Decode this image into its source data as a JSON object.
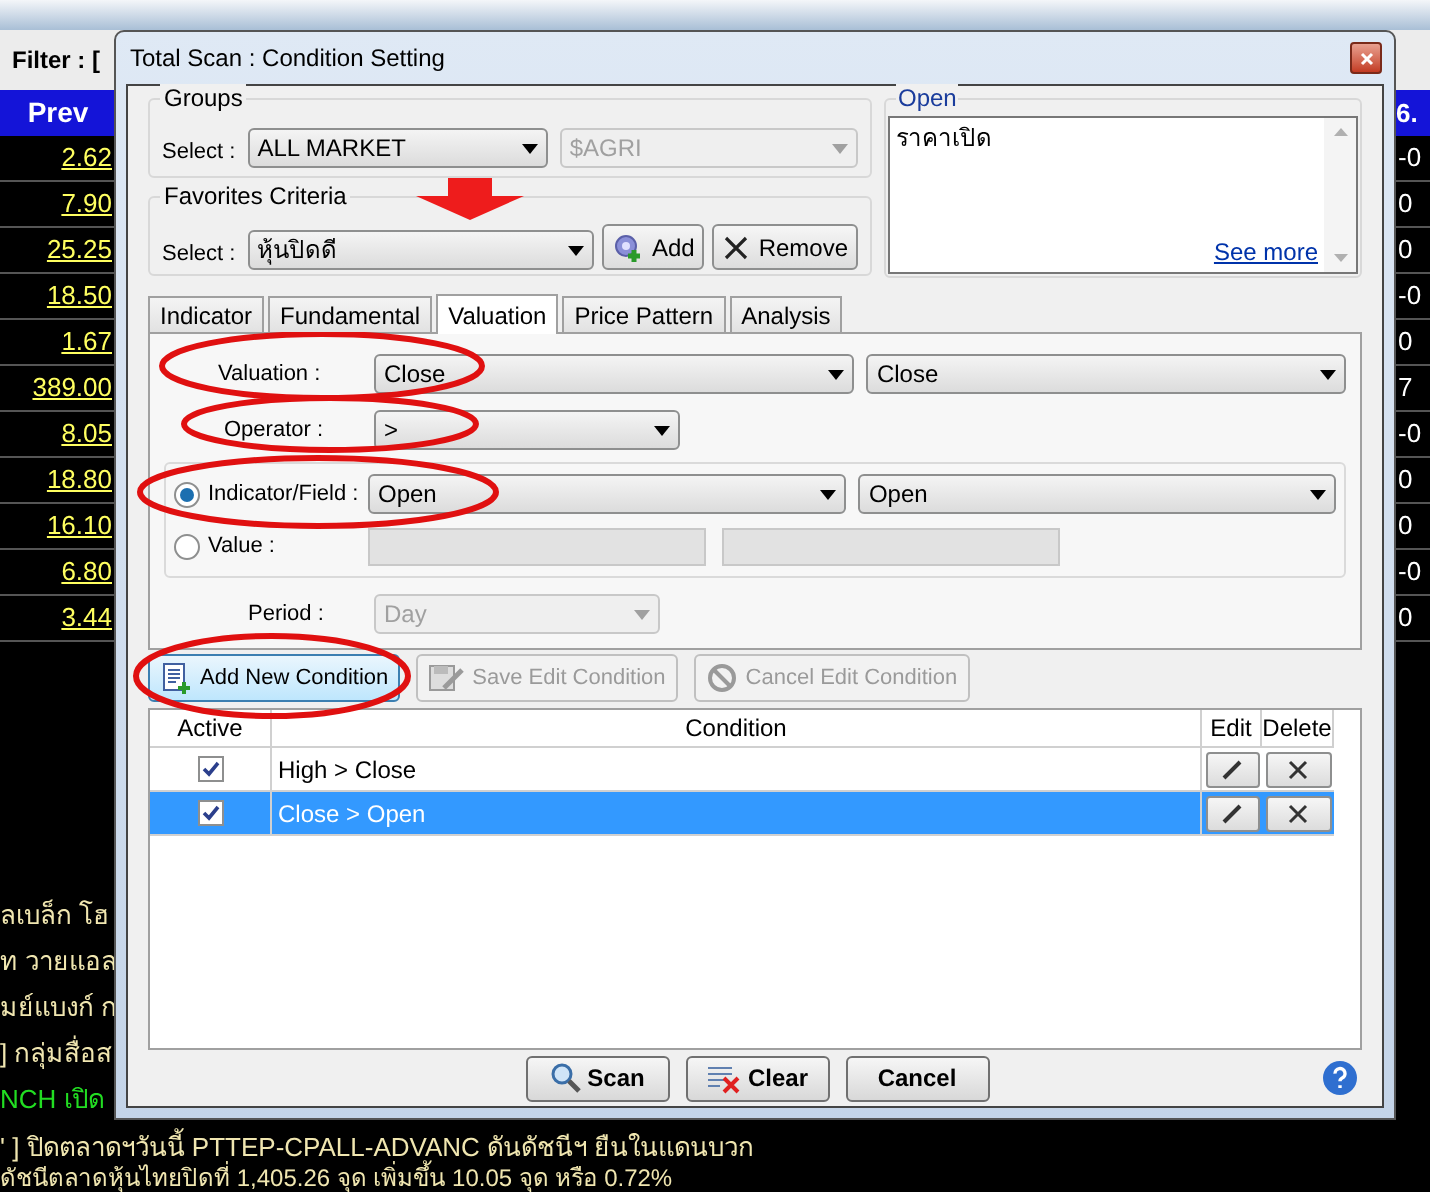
{
  "background": {
    "filter_label": "Filter : [",
    "prev_column": {
      "header": "Prev",
      "values": [
        "2.62",
        "7.90",
        "25.25",
        "18.50",
        "1.67",
        "389.00",
        "8.05",
        "18.80",
        "16.10",
        "6.80",
        "3.44"
      ]
    },
    "column_2": {
      "header": "6.",
      "values": [
        "-0",
        "0",
        "0",
        "-0",
        "0",
        "7",
        "-0",
        "0",
        "0",
        "-0",
        "0"
      ]
    },
    "news": [
      {
        "text": "ลเบล็ก โฮ",
        "color": "#f0e6b0"
      },
      {
        "text": "ท วายแอล",
        "color": "#f0e6b0"
      },
      {
        "text": "มย์แบงก์ ก",
        "color": "#f0e6b0"
      },
      {
        "text": "]  กลุ่มสื่อส",
        "color": "#f0e6b0"
      },
      {
        "text": "NCH เปิด",
        "color": "#22dd22"
      },
      {
        "text": "' ]  ปิดตลาดฯวันนี้ PTTEP-CPALL-ADVANC ดันดัชนีฯ ยืนในแดนบวก",
        "color": "#f0e6b0"
      },
      {
        "text": "ดัชนีตลาดหุ้นไทยปิดที่ 1,405.26 จุด เพิ่มขึ้น 10.05 จุด หรือ 0.72%",
        "color": "#f0e6b0"
      }
    ]
  },
  "dialog": {
    "title": "Total Scan : Condition Setting",
    "groups": {
      "legend": "Groups",
      "select_label": "Select :",
      "select": "ALL MARKET",
      "subgroup": {
        "value": "$AGRI",
        "disabled": true
      }
    },
    "favorites": {
      "legend": "Favorites Criteria",
      "select_label": "Select :",
      "select": "หุ้นปิดดี",
      "buttons": [
        "Add",
        "Remove"
      ]
    },
    "description": {
      "legend": "Open",
      "text": "ราคาเปิด",
      "link": "See more"
    },
    "tabs": [
      {
        "label": "Indicator",
        "selected": false
      },
      {
        "label": "Fundamental",
        "selected": false
      },
      {
        "label": "Valuation",
        "selected": true
      },
      {
        "label": "Price Pattern",
        "selected": false
      },
      {
        "label": "Analysis",
        "selected": false
      }
    ],
    "valuation": {
      "label": "Valuation :",
      "value": "Close",
      "value_2": "Close"
    },
    "operator": {
      "label": "Operator :",
      "value": ">"
    },
    "compare_options": [
      {
        "label": "Indicator/Field :",
        "selected": true,
        "value": "Open",
        "value_2": "Open"
      },
      {
        "label": "Value :",
        "selected": false
      }
    ],
    "period": {
      "label": "Period :",
      "value": "Day",
      "disabled": true
    },
    "condition_buttons": [
      {
        "label": "Add New Condition",
        "disabled": false
      },
      {
        "label": "Save Edit Condition",
        "disabled": true
      },
      {
        "label": "Cancel Edit Condition",
        "disabled": true
      }
    ],
    "conditions": {
      "columns": [
        "Active",
        "Condition",
        "Edit",
        "Delete"
      ],
      "rows": [
        {
          "active": true,
          "condition": "High > Close",
          "selected": false
        },
        {
          "active": true,
          "condition": "Close > Open",
          "selected": true
        }
      ]
    },
    "footer_buttons": [
      "Scan",
      "Clear",
      "Cancel"
    ]
  }
}
